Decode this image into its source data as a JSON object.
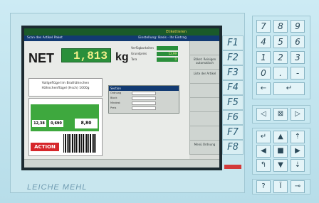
{
  "screen": {
    "title_right": "Etikettieren",
    "subbar_left": "Scan des Artikel Paket",
    "subbar_right": "Einstellung: Basis - Ihr Eintrag",
    "net_label": "NET",
    "net_value": "1,813",
    "net_unit": "kg",
    "minor_fields": [
      {
        "label": "Verfügbarkeiten",
        "value": ""
      },
      {
        "label": "Grundpreis",
        "value": "12,99"
      },
      {
        "label": "Tara",
        "value": "0"
      }
    ],
    "info_line": "",
    "product_lines": [
      "Vollgeflügel im Brathähnchen",
      "Hähnchenflügel (Hsch) 1000g"
    ],
    "label_price1": "12,38",
    "label_price2": "0,690",
    "label_price3": "8,80",
    "action_text": "ACTION",
    "section_title": "Section",
    "section_fields": [
      "Ordnung",
      "Block",
      "Mindest",
      "Preis"
    ],
    "right_keys": [
      "",
      "Etiket. Reinigen automatisch",
      "Liste der Artikel",
      "",
      "",
      "",
      "",
      "Menü Ordnung"
    ]
  },
  "function_keys": [
    "F1",
    "F2",
    "F3",
    "F4",
    "F5",
    "F6",
    "F7",
    "F8"
  ],
  "keypad": {
    "digits": [
      "7",
      "8",
      "9",
      "4",
      "5",
      "6",
      "1",
      "2",
      "3",
      "0",
      ".",
      "-"
    ],
    "left_arrow": "←",
    "enter": "↵"
  },
  "brand": "LEICHE MEHL"
}
